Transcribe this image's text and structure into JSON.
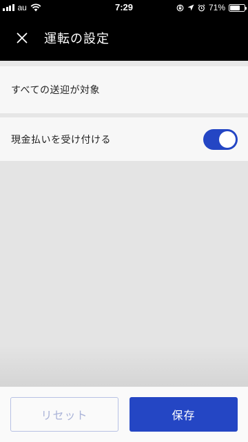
{
  "status_bar": {
    "carrier": "au",
    "time": "7:29",
    "battery_percent": "71%",
    "battery_level": 0.71
  },
  "header": {
    "close_icon": "close-icon",
    "title": "運転の設定"
  },
  "settings": {
    "ride_target_label": "すべての送迎が対象",
    "accept_cash_label": "現金払いを受け付ける",
    "accept_cash_enabled": true
  },
  "footer": {
    "reset_label": "リセット",
    "save_label": "保存"
  },
  "colors": {
    "accent": "#2446c4",
    "reset_text": "#aab3d8"
  }
}
